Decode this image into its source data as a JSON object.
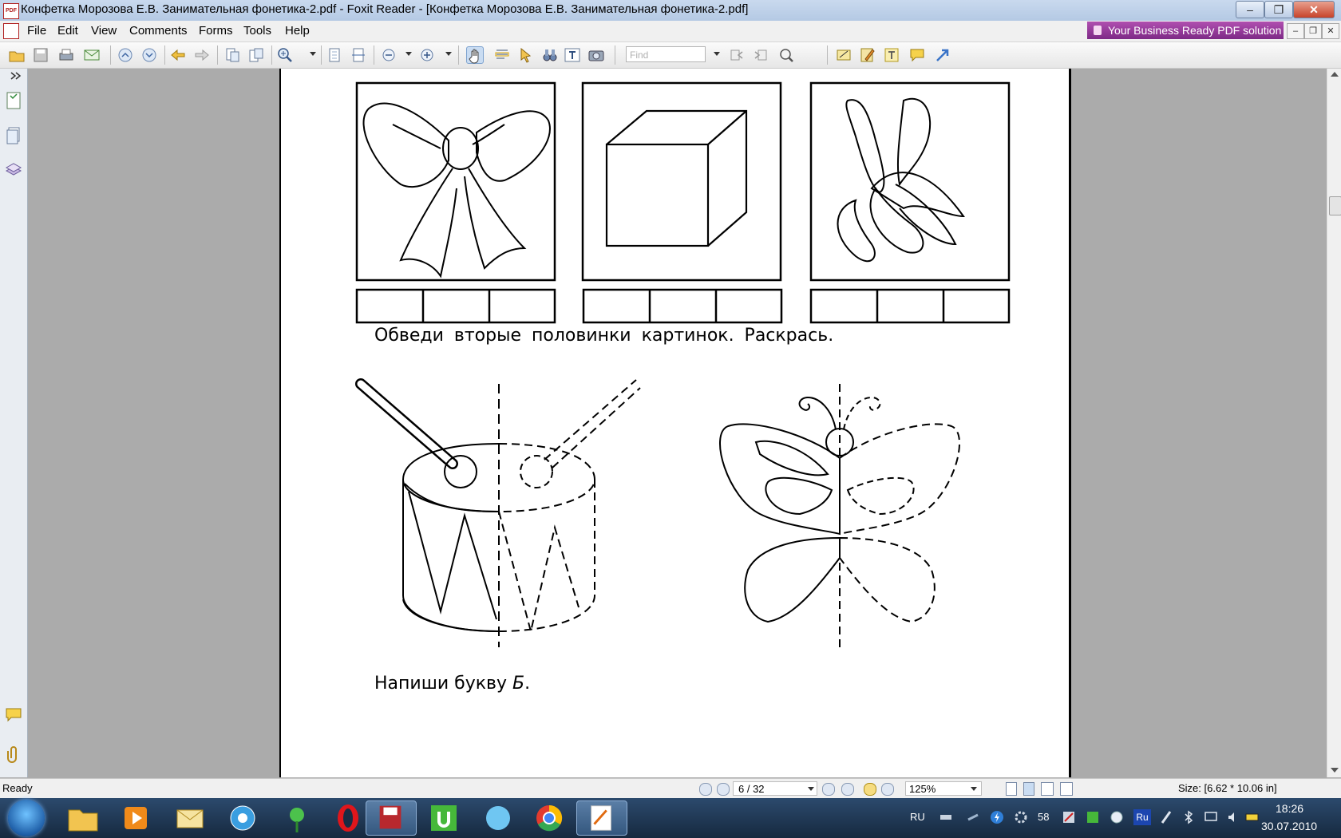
{
  "window": {
    "title": "Конфетка Морозова Е.В. Занимательная фонетика-2.pdf - Foxit Reader - [Конфетка Морозова Е.В. Занимательная фонетика-2.pdf]",
    "minimize": "‒",
    "restore": "❐",
    "close": "✕"
  },
  "menu": {
    "items": [
      "File",
      "Edit",
      "View",
      "Comments",
      "Forms",
      "Tools",
      "Help"
    ],
    "promo": "Your Business Ready PDF solution",
    "mdi_min": "–",
    "mdi_restore": "❐",
    "mdi_close": "✕"
  },
  "toolbar": {
    "find_placeholder": "Find"
  },
  "document": {
    "instruction_1": "Обведи вторые половинки картинок. Раскрась.",
    "instruction_2_prefix": "Напиши букву ",
    "instruction_2_letter": "Б",
    "instruction_2_suffix": "."
  },
  "status": {
    "ready": "Ready",
    "page": "6 / 32",
    "zoom": "125%",
    "size": "Size: [6.62 * 10.06 in]"
  },
  "taskbar": {
    "lang": "RU",
    "tray_count": "58",
    "tray_lang": "Ru",
    "time": "18:26",
    "date": "30.07.2010"
  },
  "colors": {
    "titlebar": "#c9d9ee",
    "promo": "#8e3595",
    "taskbar": "#1f3a5a",
    "page": "#ffffff",
    "docbg": "#ababab"
  }
}
